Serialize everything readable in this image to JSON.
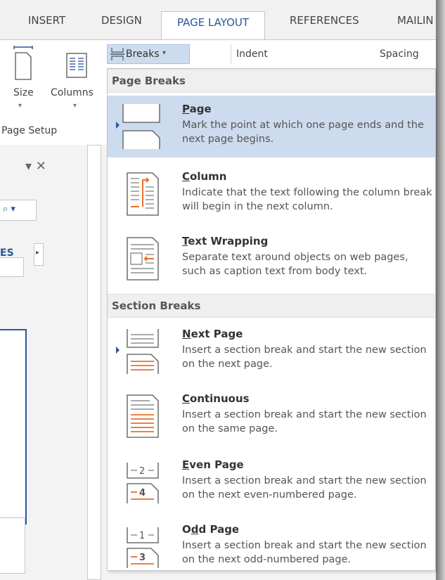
{
  "ribbon": {
    "tabs": [
      "INSERT",
      "DESIGN",
      "PAGE LAYOUT",
      "REFERENCES",
      "MAILIN"
    ],
    "active_tab": "PAGE LAYOUT",
    "breaks_label": "Breaks",
    "indent_label": "Indent",
    "spacing_label": "Spacing",
    "size_label": "Size",
    "columns_label": "Columns",
    "group_label": "Page Setup"
  },
  "left_pane": {
    "close_glyph": "▾ ✕",
    "search_glyph": "⌕ ▾",
    "tab_label": "ES",
    "scroll_glyph": "▸"
  },
  "menu": {
    "page_breaks_header": "Page Breaks",
    "section_breaks_header": "Section Breaks",
    "items": [
      {
        "key": "P",
        "rest": "age",
        "title": "Page",
        "desc": "Mark the point at which one page ends and the next page begins."
      },
      {
        "key": "C",
        "rest": "olumn",
        "title": "Column",
        "desc": "Indicate that the text following the column break will begin in the next column."
      },
      {
        "key": "T",
        "rest": "ext Wrapping",
        "title": "Text Wrapping",
        "desc": "Separate text around objects on web pages, such as caption text from body text."
      },
      {
        "key": "N",
        "rest": "ext Page",
        "title": "Next Page",
        "desc": "Insert a section break and start the new section on the next page."
      },
      {
        "pre": "",
        "key": "C",
        "rest": "ontinuous",
        "title": "Continuous",
        "desc": "Insert a section break and start the new section on the same page."
      },
      {
        "key": "E",
        "rest": "ven Page",
        "title": "Even Page",
        "desc": "Insert a section break and start the new section on the next even-numbered page."
      },
      {
        "pre": "O",
        "key": "d",
        "rest": "d Page",
        "title": "Odd Page",
        "desc": "Insert a section break and start the new section on the next odd-numbered page."
      }
    ],
    "even_icon_numbers": [
      "2",
      "4"
    ],
    "odd_icon_numbers": [
      "1",
      "3"
    ]
  },
  "colors": {
    "accent": "#2b579a",
    "selected": "#cddbee",
    "orange": "#e8702a"
  }
}
